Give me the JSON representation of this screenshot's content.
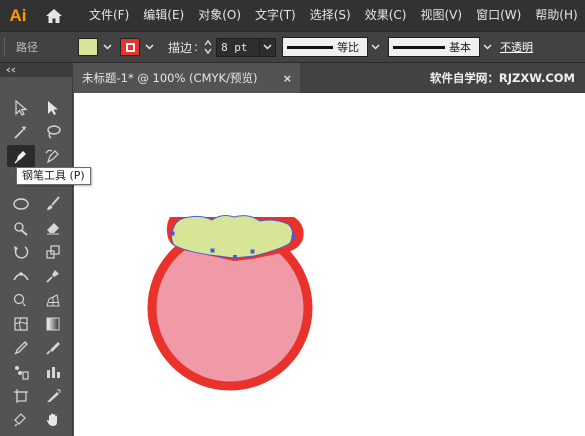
{
  "app": {
    "logo": "Ai"
  },
  "menu": [
    "文件(F)",
    "编辑(E)",
    "对象(O)",
    "文字(T)",
    "选择(S)",
    "效果(C)",
    "视图(V)",
    "窗口(W)",
    "帮助(H)"
  ],
  "control": {
    "object_label": "路径",
    "fill_color": "#d7e597",
    "stroke_color": "#e8322b",
    "stroke_label": "描边",
    "stroke_weight": "8 pt",
    "profile_label": "等比",
    "brush_label": "基本",
    "opacity_label": "不透明"
  },
  "tooltip": "钢笔工具 (P)",
  "doc": {
    "tab_title": "未标题-1* @ 100% (CMYK/预览)",
    "close_glyph": "×",
    "watermark": "软件自学网：RJZXW.COM"
  },
  "artwork": {
    "body_fill": "#f09aa8",
    "body_stroke": "#e8322b",
    "cap_fill": "#d7e597",
    "anchor_color": "#4a5cd6"
  },
  "tools": [
    [
      "selection-icon",
      "direct-selection-icon"
    ],
    [
      "magic-wand-icon",
      "lasso-icon"
    ],
    [
      "pen-icon",
      "curvature-icon"
    ],
    [
      "type-icon",
      "line-icon"
    ],
    [
      "ellipse-icon",
      "paintbrush-icon"
    ],
    [
      "shaper-icon",
      "eraser-icon"
    ],
    [
      "rotate-icon",
      "scale-icon"
    ],
    [
      "width-icon",
      "puppet-warp-icon"
    ],
    [
      "shape-builder-icon",
      "perspective-grid-icon"
    ],
    [
      "mesh-icon",
      "gradient-icon"
    ],
    [
      "eyedropper-icon",
      "blend-icon"
    ],
    [
      "symbol-sprayer-icon",
      "column-graph-icon"
    ],
    [
      "artboard-icon",
      "slice-icon"
    ],
    [
      "hand-icon",
      "zoom-icon"
    ]
  ]
}
